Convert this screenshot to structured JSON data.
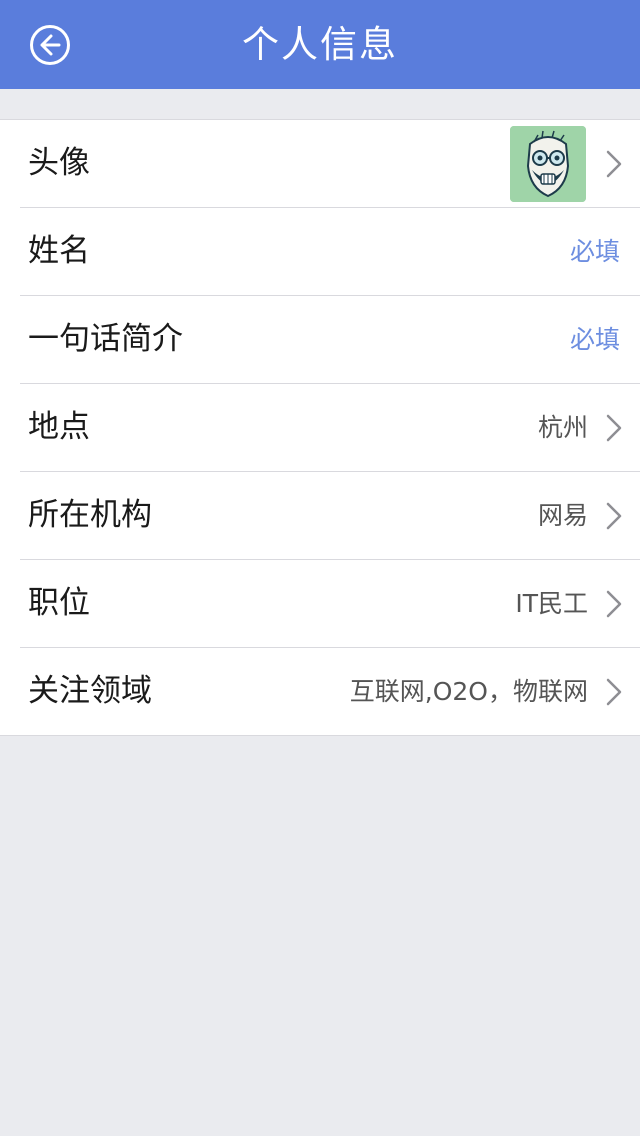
{
  "nav": {
    "title": "个人信息",
    "back_icon": "back-arrow-icon",
    "color": "#5a7ddc"
  },
  "rows": [
    {
      "label": "头像",
      "value": "",
      "type": "avatar"
    },
    {
      "label": "姓名",
      "value": "必填",
      "type": "required"
    },
    {
      "label": "一句话简介",
      "value": "必填",
      "type": "required"
    },
    {
      "label": "地点",
      "value": "杭州",
      "type": "chevron"
    },
    {
      "label": "所在机构",
      "value": "网易",
      "type": "chevron"
    },
    {
      "label": "职位",
      "value": "IT民工",
      "type": "chevron"
    },
    {
      "label": "关注领域",
      "value": "互联网,O2O，物联网",
      "type": "chevron"
    }
  ],
  "colors": {
    "required_text": "#6d8ee0",
    "avatar_bg": "#9fd4a8"
  }
}
